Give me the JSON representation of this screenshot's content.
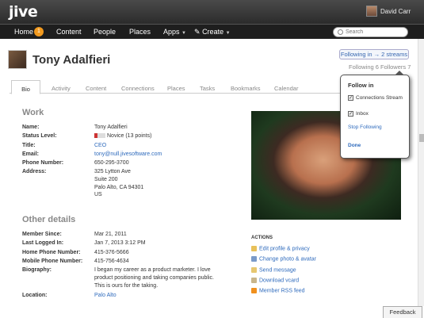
{
  "header": {
    "logo": "jive",
    "user_name": "David Carr"
  },
  "nav": {
    "home": "Home",
    "home_badge": "1",
    "content": "Content",
    "people": "People",
    "places": "Places",
    "apps": "Apps",
    "create": "Create"
  },
  "search": {
    "placeholder": "Search"
  },
  "profile": {
    "name": "Tony Adalfieri",
    "follow_button": "Following in → 2 streams",
    "following_count": "Following 6",
    "followers_count": "Followers 7"
  },
  "tabs": [
    "Bio",
    "Activity",
    "Content",
    "Connections",
    "Places",
    "Tasks",
    "Bookmarks",
    "Calendar"
  ],
  "work": {
    "heading": "Work",
    "fields": [
      {
        "label": "Name:",
        "value": "Tony Adalfieri"
      },
      {
        "label": "Status Level:",
        "value": "Novice (13 points)"
      },
      {
        "label": "Title:",
        "value": "CEO"
      },
      {
        "label": "Email:",
        "value": "tony@null.jivesoftware.com"
      },
      {
        "label": "Phone Number:",
        "value": "650-295-3700"
      },
      {
        "label": "Address:",
        "value": "325 Lytton Ave"
      }
    ],
    "address_lines": [
      "Suite 200",
      "Palo Alto, CA 94301",
      "US"
    ]
  },
  "other": {
    "heading": "Other details",
    "fields": [
      {
        "label": "Member Since:",
        "value": "Mar 21, 2011"
      },
      {
        "label": "Last Logged In:",
        "value": "Jan 7, 2013 3:12 PM"
      },
      {
        "label": "Home Phone Number:",
        "value": "415-376-5666"
      },
      {
        "label": "Mobile Phone Number:",
        "value": "415-756-4634"
      },
      {
        "label": "Biography:",
        "value": "I began my career as a product marketer. I love"
      },
      {
        "label": "Location:",
        "value": "Palo Alto"
      }
    ],
    "bio_lines": [
      "product positioning and taking companies public.",
      "This is ours for the taking."
    ]
  },
  "actions": {
    "title": "ACTIONS",
    "items": [
      "Edit profile & privacy",
      "Change photo & avatar",
      "Send message",
      "Download vcard",
      "Member RSS feed"
    ]
  },
  "popup": {
    "title": "Follow in",
    "options": [
      "Connections Stream",
      "Inbox"
    ],
    "stop": "Stop Following",
    "done": "Done"
  },
  "feedback": "Feedback"
}
